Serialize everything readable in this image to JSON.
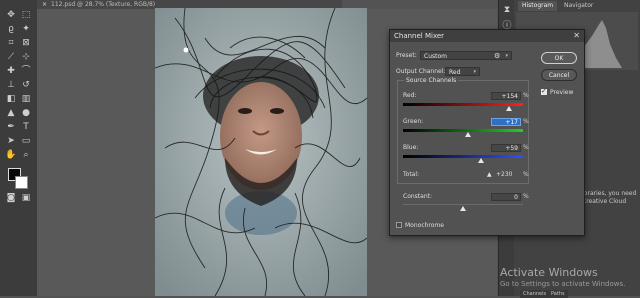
{
  "document_tab": {
    "title": "112.psd @ 28.7% (Texture, RGB/8)"
  },
  "panels": {
    "tabs": [
      "Histogram",
      "Navigator"
    ],
    "bottom_tabs": [
      "Channels",
      "Paths"
    ],
    "side_text": [
      "ibraries, you need",
      "Creative Cloud"
    ]
  },
  "watermark": {
    "title": "Activate Windows",
    "subtitle": "Go to Settings to activate Windows."
  },
  "dialog": {
    "title": "Channel Mixer",
    "preset_label": "Preset:",
    "preset_value": "Custom",
    "output_label": "Output Channel:",
    "output_value": "Red",
    "ok_label": "OK",
    "cancel_label": "Cancel",
    "preview_label": "Preview",
    "preview_checked": true,
    "source_label": "Source Channels",
    "channels": [
      {
        "name": "Red:",
        "value": "+154",
        "level": 0.885,
        "gradient": [
          "#000000",
          "#ff2020"
        ]
      },
      {
        "name": "Green:",
        "value": "+17",
        "level": 0.5425,
        "gradient": [
          "#000000",
          "#20d020"
        ]
      },
      {
        "name": "Blue:",
        "value": "+59",
        "level": 0.6475,
        "gradient": [
          "#000000",
          "#3050ff"
        ]
      }
    ],
    "total_label": "Total:",
    "total_value": "+230",
    "constant_label": "Constant:",
    "constant_value": "0",
    "constant_level": 0.5,
    "monochrome_label": "Monochrome",
    "monochrome_checked": false,
    "percent": "%",
    "warning_icon": "warning-icon",
    "settings_icon": "gear-icon",
    "close_icon": "close-icon"
  }
}
